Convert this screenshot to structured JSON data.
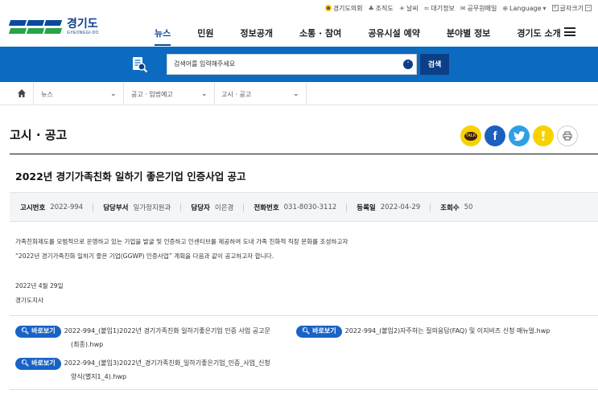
{
  "utility": {
    "items": [
      "경기도의회",
      "조직도",
      "날씨",
      "대기정보",
      "공무원메일",
      "Language",
      "글자크기"
    ]
  },
  "logo": {
    "korean": "경기도",
    "english": "GYEONGGI-DO"
  },
  "gnb": {
    "items": [
      "뉴스",
      "민원",
      "정보공개",
      "소통 · 참여",
      "공유시설 예약",
      "분야별 정보",
      "경기도 소개"
    ],
    "active": "뉴스"
  },
  "search": {
    "placeholder": "검색어를 입력해주세요",
    "button": "검색"
  },
  "breadcrumb": {
    "level1": "뉴스",
    "level2": "공고 · 입법예고",
    "level3": "고시 · 공고"
  },
  "page": {
    "title": "고시 · 공고"
  },
  "share": {
    "kakao_label": "TALK"
  },
  "article": {
    "title": "2022년 경기가족친화 일하기 좋은기업 인증사업 공고",
    "meta": [
      {
        "label": "고시번호",
        "value": "2022-994"
      },
      {
        "label": "담당부서",
        "value": "일가정지원과"
      },
      {
        "label": "담당자",
        "value": "이은경"
      },
      {
        "label": "전화번호",
        "value": "031-8030-3112"
      },
      {
        "label": "등록일",
        "value": "2022-04-29"
      },
      {
        "label": "조회수",
        "value": "50"
      }
    ],
    "body": {
      "line1": "가족친화제도를 모범적으로 운영하고 있는 기업을 발굴 및 인증하고 인센티브를 제공하여 도내 가족 친화적 직장 문화를 조성하고자",
      "line2": "“2022년 경기가족친화 일하기 좋은 기업(GGWP) 인증사업” 계획을 다음과 같이 공고하고자 합니다.",
      "date": "2022년 4월 29일",
      "signer": "경기도지사"
    }
  },
  "attachments": {
    "button_label": "바로보기",
    "files": [
      {
        "line1": "2022-994_(붙임1)2022년 경기가족친화 일하기좋은기업 인증 사업 공고문",
        "line2": "(최종).hwp"
      },
      {
        "line1": "2022-994_(붙임2)자주하는 질의응답(FAQ) 및 이지비즈 신청 매뉴얼.hwp",
        "line2": ""
      },
      {
        "line1": "2022-994_(붙임3)2022년_경기가족친화_일하기좋은기업_인증_사업_신청",
        "line2": "양식(별지1_4).hwp"
      }
    ]
  },
  "colors": {
    "primary": "#0c6bc0",
    "navy": "#0c3f86",
    "attach_button": "#1a63c6"
  }
}
